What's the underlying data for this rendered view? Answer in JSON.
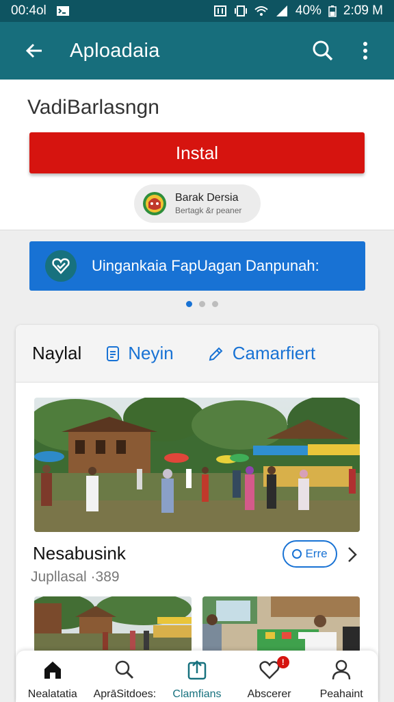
{
  "status_bar": {
    "time_left": "00:4ol",
    "battery": "40%",
    "time_right": "2:0̈9 M"
  },
  "app_bar": {
    "title": "Aploadaia",
    "back_icon": "arrow-back-icon",
    "search_icon": "search-icon",
    "more_icon": "more-vert-icon"
  },
  "app": {
    "name": "VadiBarlasngn",
    "install_label": "Instal",
    "developer_name": "Barak Dersia",
    "developer_sub": "Bertagk &r peaner"
  },
  "banner": {
    "text": "Uingankaia FapUagan Danpunah:",
    "icon": "heart-shield-icon"
  },
  "carousel": {
    "count": 3,
    "active": 0
  },
  "card": {
    "tabs": [
      {
        "label": "Naylal"
      },
      {
        "label": "Neyin",
        "icon": "document-icon"
      },
      {
        "label": "Camarfiert",
        "icon": "pencil-icon"
      }
    ],
    "item_title": "Nesabusink",
    "item_subtitle": "Jupllasal ·389",
    "open_label": "Erre"
  },
  "bottom_nav": [
    {
      "label": "Nealatatia",
      "icon": "home-icon"
    },
    {
      "label": "AprāSitdoes:",
      "icon": "search-icon"
    },
    {
      "label": "Clamfians",
      "icon": "upload-icon",
      "active": true
    },
    {
      "label": "Abscerer",
      "icon": "heart-icon",
      "badge": "!"
    },
    {
      "label": "Peahaint",
      "icon": "person-icon"
    }
  ],
  "colors": {
    "status_bar": "#0e5461",
    "app_bar": "#176e7c",
    "install": "#d6140f",
    "banner": "#1872d4"
  }
}
